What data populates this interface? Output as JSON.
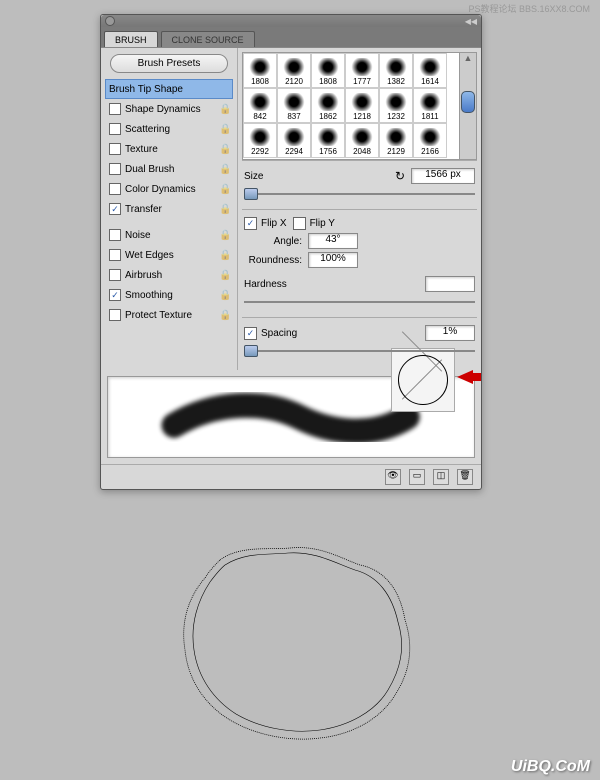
{
  "watermarks": {
    "top": "PS教程论坛 BBS.16XX8.COM",
    "bottom": "UiBQ.CoM"
  },
  "tabs": {
    "active": "BRUSH",
    "inactive": "CLONE SOURCE"
  },
  "presets_button": "Brush Presets",
  "side_items": [
    {
      "label": "Brush Tip Shape",
      "checked": null,
      "selected": true,
      "lock": false
    },
    {
      "label": "Shape Dynamics",
      "checked": false,
      "selected": false,
      "lock": true
    },
    {
      "label": "Scattering",
      "checked": false,
      "selected": false,
      "lock": true
    },
    {
      "label": "Texture",
      "checked": false,
      "selected": false,
      "lock": true
    },
    {
      "label": "Dual Brush",
      "checked": false,
      "selected": false,
      "lock": true
    },
    {
      "label": "Color Dynamics",
      "checked": false,
      "selected": false,
      "lock": true
    },
    {
      "label": "Transfer",
      "checked": true,
      "selected": false,
      "lock": true
    }
  ],
  "side_items2": [
    {
      "label": "Noise",
      "checked": false,
      "lock": true
    },
    {
      "label": "Wet Edges",
      "checked": false,
      "lock": true
    },
    {
      "label": "Airbrush",
      "checked": false,
      "lock": true
    },
    {
      "label": "Smoothing",
      "checked": true,
      "lock": true
    },
    {
      "label": "Protect Texture",
      "checked": false,
      "lock": true
    }
  ],
  "brushes": [
    [
      "1808",
      "2120",
      "1808",
      "1777",
      "1382",
      "1614"
    ],
    [
      "842",
      "837",
      "1862",
      "1218",
      "1232",
      "1811"
    ],
    [
      "2292",
      "2294",
      "1756",
      "2048",
      "2129",
      "2166"
    ]
  ],
  "size": {
    "label": "Size",
    "value": "1566 px"
  },
  "flip": {
    "x_label": "Flip X",
    "x_checked": true,
    "y_label": "Flip Y",
    "y_checked": false
  },
  "angle": {
    "label": "Angle:",
    "value": "43°"
  },
  "roundness": {
    "label": "Roundness:",
    "value": "100%"
  },
  "hardness": {
    "label": "Hardness",
    "value": ""
  },
  "spacing": {
    "label": "Spacing",
    "checked": true,
    "value": "1%"
  },
  "icons": {
    "lock": "🔒",
    "check": "✓",
    "reset": "↻"
  }
}
